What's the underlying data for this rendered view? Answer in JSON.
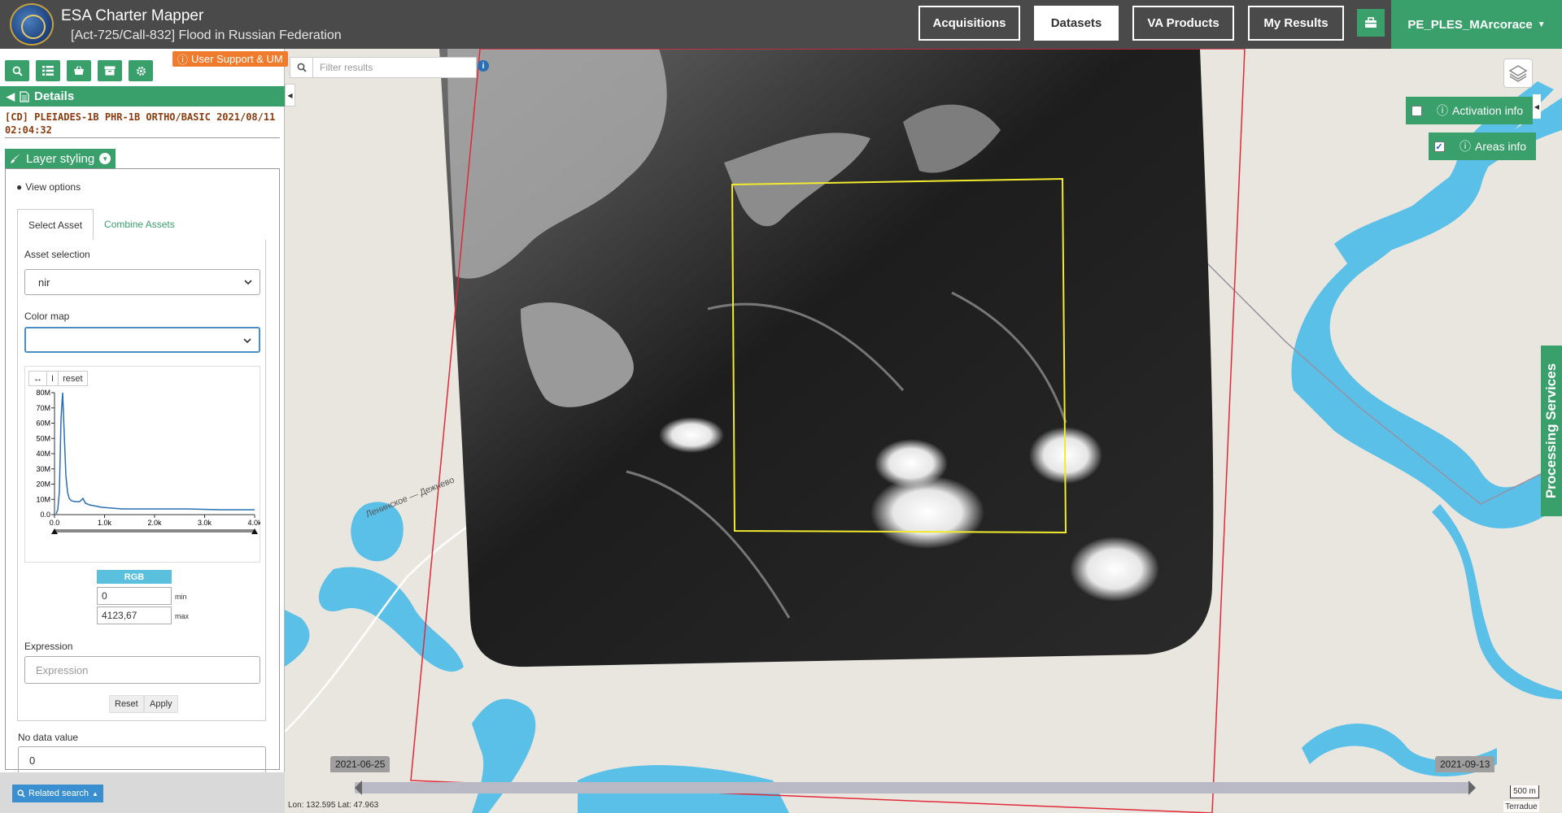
{
  "header": {
    "app_title": "ESA Charter Mapper",
    "subtitle": "[Act-725/Call-832] Flood in Russian Federation",
    "nav": [
      "Acquisitions",
      "Datasets",
      "VA Products",
      "My Results"
    ],
    "active_nav": "Datasets",
    "user": "PE_PLES_MArcorace"
  },
  "support_label": "User Support & UM",
  "panel": {
    "details_label": "Details",
    "product_title": "[CD] PLEIADES-1B PHR-1B ORTHO/BASIC 2021/08/11 02:04:32",
    "layer_styling_label": "Layer styling",
    "view_options_label": "View options",
    "tabs": [
      "Select Asset",
      "Combine Assets"
    ],
    "asset_selection_label": "Asset selection",
    "asset_selected": "nir",
    "color_map_label": "Color map",
    "color_map_selected": "",
    "histogram": {
      "buttons": [
        "↔",
        "I",
        "reset"
      ],
      "y_ticks": [
        "80M",
        "70M",
        "60M",
        "50M",
        "40M",
        "30M",
        "20M",
        "10M",
        "0.0"
      ],
      "x_ticks": [
        "0.0",
        "1.0k",
        "2.0k",
        "3.0k",
        "4.0k"
      ]
    },
    "rgb_label": "RGB",
    "min_value": "0",
    "min_label": "min",
    "max_value": "4123,67",
    "max_label": "max",
    "expression_label": "Expression",
    "expression_placeholder": "Expression",
    "reset_label": "Reset",
    "apply_label": "Apply",
    "nodata_label": "No data value",
    "nodata_value": "0",
    "related_search_label": "Related search"
  },
  "map": {
    "filter_placeholder": "Filter results",
    "road_label": "Ленинское — Дежнево",
    "activation_info_label": "Activation info",
    "activation_checked": false,
    "areas_info_label": "Areas info",
    "areas_checked": true,
    "processing_label": "Processing Services",
    "timeline_start": "2021-06-25",
    "timeline_end": "2021-09-13",
    "coords": "Lon: 132.595 Lat: 47.963",
    "scale": "500 m",
    "attribution": "Terradue"
  },
  "colors": {
    "accent_green": "#3aa06b",
    "header_gray": "#4a4a4a",
    "water": "#5bc0e8",
    "footprint_red": "#e02a3a",
    "aoi_yellow": "#f2ea2e",
    "support_orange": "#f07b2d"
  }
}
